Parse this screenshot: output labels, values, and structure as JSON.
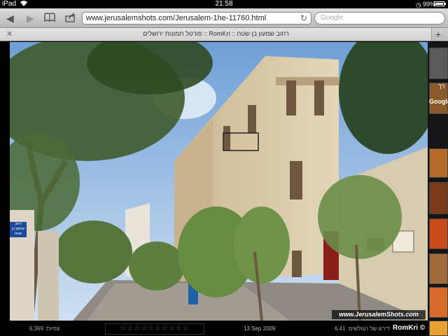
{
  "status_bar": {
    "device": "iPad",
    "time": "21:58",
    "battery_pct": "99%",
    "battery_level": 0.99
  },
  "toolbar": {
    "url": "www.jerusalemshots.com/Jerusalem-1he-11760.html",
    "search_placeholder": "Google"
  },
  "tab": {
    "title": "פורטל תמונות ירושלים :: RomKri :: רחוב שמעון בן שטח"
  },
  "photo": {
    "watermark": "www.JerusalemShots.com",
    "sign_text": "רחוב שמעון בן שטח"
  },
  "sidebar": {
    "label_1": "רך",
    "label_2": "Google"
  },
  "bottom_bar": {
    "views": "צפיות: 6,369",
    "stars": "☆☆☆☆☆☆☆☆☆☆",
    "date": "13 Sep 2009",
    "rating": "דירוג של הגולשים: 6.41",
    "author": "RomKri ©"
  },
  "colors": {
    "toolbar": "#c8c8c8",
    "page_bg": "#000000",
    "sky": "#9ec3e6",
    "building": "#d9c9a8"
  }
}
